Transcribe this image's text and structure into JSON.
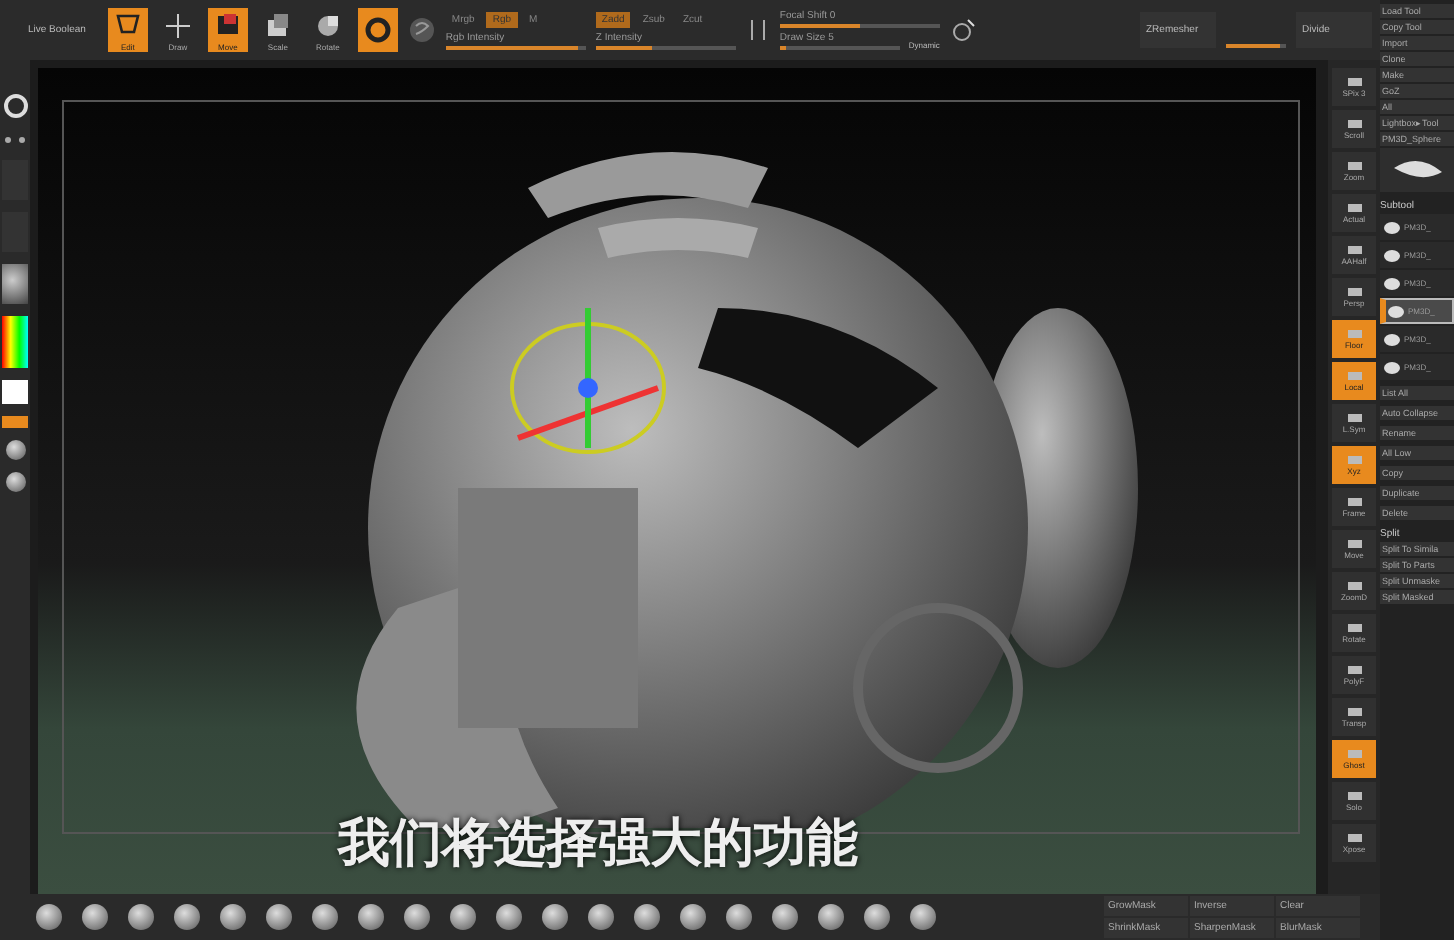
{
  "toolbar": {
    "mode_label": "Live Boolean",
    "tools": [
      {
        "label": "Edit",
        "selected": true
      },
      {
        "label": "Draw",
        "selected": false
      },
      {
        "label": "Move",
        "selected": true
      },
      {
        "label": "Scale",
        "selected": false
      },
      {
        "label": "Rotate",
        "selected": false
      }
    ],
    "gizmo": {
      "selected": true
    },
    "rgb_channels": [
      {
        "label": "Mrgb",
        "selected": false
      },
      {
        "label": "Rgb",
        "selected": true
      },
      {
        "label": "M",
        "selected": false
      }
    ],
    "rgb_intensity": {
      "label": "Rgb Intensity",
      "level": 0.95
    },
    "z_channels": [
      {
        "label": "Zadd",
        "selected": true
      },
      {
        "label": "Zsub",
        "selected": false
      },
      {
        "label": "Zcut",
        "selected": false
      }
    ],
    "z_intensity": {
      "label": "Z Intensity",
      "level": 0.4
    },
    "focal_shift": {
      "label": "Focal Shift 0",
      "level": 0.5
    },
    "draw_size": {
      "label": "Draw Size 5",
      "level": 0.05
    },
    "dynamic": "Dynamic",
    "zremesher": "ZRemesher",
    "divide": "Divide",
    "target_slider": {
      "level": 0.9
    }
  },
  "right_shelf": [
    {
      "label": "SPix 3",
      "selected": false
    },
    {
      "label": "Scroll",
      "selected": false
    },
    {
      "label": "Zoom",
      "selected": false
    },
    {
      "label": "Actual",
      "selected": false
    },
    {
      "label": "AAHalf",
      "selected": false
    },
    {
      "label": "Persp",
      "selected": false
    },
    {
      "label": "Floor",
      "selected": true
    },
    {
      "label": "Local",
      "selected": true
    },
    {
      "label": "L.Sym",
      "selected": false
    },
    {
      "label": "Xyz",
      "selected": true
    },
    {
      "label": "Frame",
      "selected": false
    },
    {
      "label": "Move",
      "selected": false
    },
    {
      "label": "ZoomD",
      "selected": false
    },
    {
      "label": "Rotate",
      "selected": false
    },
    {
      "label": "PolyF",
      "selected": false
    },
    {
      "label": "Transp",
      "selected": false
    },
    {
      "label": "Ghost",
      "selected": true
    },
    {
      "label": "Solo",
      "selected": false
    },
    {
      "label": "Xpose",
      "selected": false
    }
  ],
  "tool_panel": {
    "buttons": [
      "Load Tool",
      "Copy Tool",
      "Import",
      "Clone",
      "Make",
      "GoZ",
      "All",
      "Lightbox▸Tool",
      "PM3D_Sphere"
    ],
    "subtool_title": "Subtool",
    "subtools": [
      {
        "name": "PM3D_",
        "selected": false
      },
      {
        "name": "PM3D_",
        "selected": false
      },
      {
        "name": "PM3D_",
        "selected": false
      },
      {
        "name": "PM3D_",
        "selected": true
      },
      {
        "name": "PM3D_",
        "selected": false
      },
      {
        "name": "PM3D_",
        "selected": false
      }
    ],
    "actions": [
      "List All",
      "Auto Collapse",
      "Rename",
      "All Low",
      "Copy",
      "Duplicate",
      "Delete"
    ],
    "split_title": "Split",
    "split_actions": [
      "Split To Simila",
      "Split To Parts",
      "Split Unmaske",
      "Split Masked"
    ]
  },
  "subtitle": "我们将选择强大的功能",
  "mask_buttons": [
    "GrowMask",
    "Inverse",
    "Clear",
    "ShrinkMask",
    "SharpenMask",
    "BlurMask"
  ]
}
